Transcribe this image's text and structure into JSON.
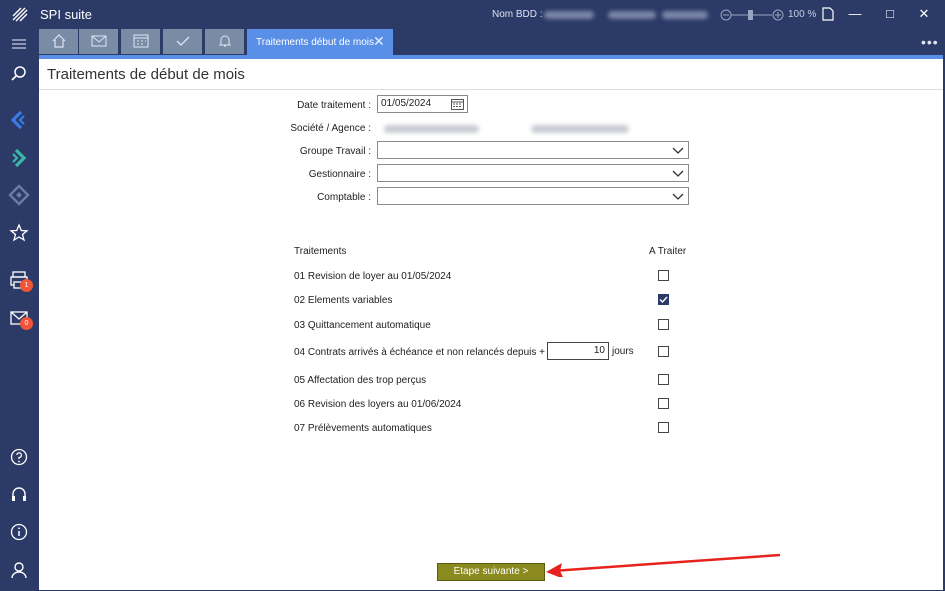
{
  "app": {
    "title": "SPI suite",
    "db_label": "Nom BDD :",
    "zoom": "100 %"
  },
  "tabs": {
    "active_label": "Traitements début de mois",
    "icons": [
      "home-icon",
      "mail-icon",
      "calendar-icon",
      "check-icon",
      "bell-icon"
    ]
  },
  "sidebar": {
    "print_badge": "1",
    "mail_badge": "0"
  },
  "page": {
    "title": "Traitements de début de mois"
  },
  "form": {
    "date_label": "Date traitement :",
    "date_value": "01/05/2024",
    "societe_label": "Société / Agence :",
    "groupe_label": "Groupe Travail :",
    "gestionnaire_label": "Gestionnaire :",
    "comptable_label": "Comptable :"
  },
  "table": {
    "header_treatments": "Traitements",
    "header_todo": "A Traiter",
    "rows": [
      {
        "label": "01 Revision de loyer au 01/05/2024",
        "checked": false
      },
      {
        "label": "02 Elements variables",
        "checked": true
      },
      {
        "label": "03 Quittancement automatique",
        "checked": false
      },
      {
        "label": "04 Contrats arrivés à échéance et non relancés depuis + de",
        "checked": false
      },
      {
        "label": "05 Affectation des trop perçus",
        "checked": false
      },
      {
        "label": "06 Revision des loyers au 01/06/2024",
        "checked": false
      },
      {
        "label": "07 Prélèvements automatiques",
        "checked": false
      }
    ],
    "days_value": "10",
    "days_unit": "jours"
  },
  "footer": {
    "next_label": "Etape suivante >"
  },
  "colors": {
    "chrome": "#2b3a67",
    "accent": "#5a8fe8",
    "next_button": "#8a8a1e",
    "arrow": "#e8231e",
    "badge": "#f0553a"
  }
}
